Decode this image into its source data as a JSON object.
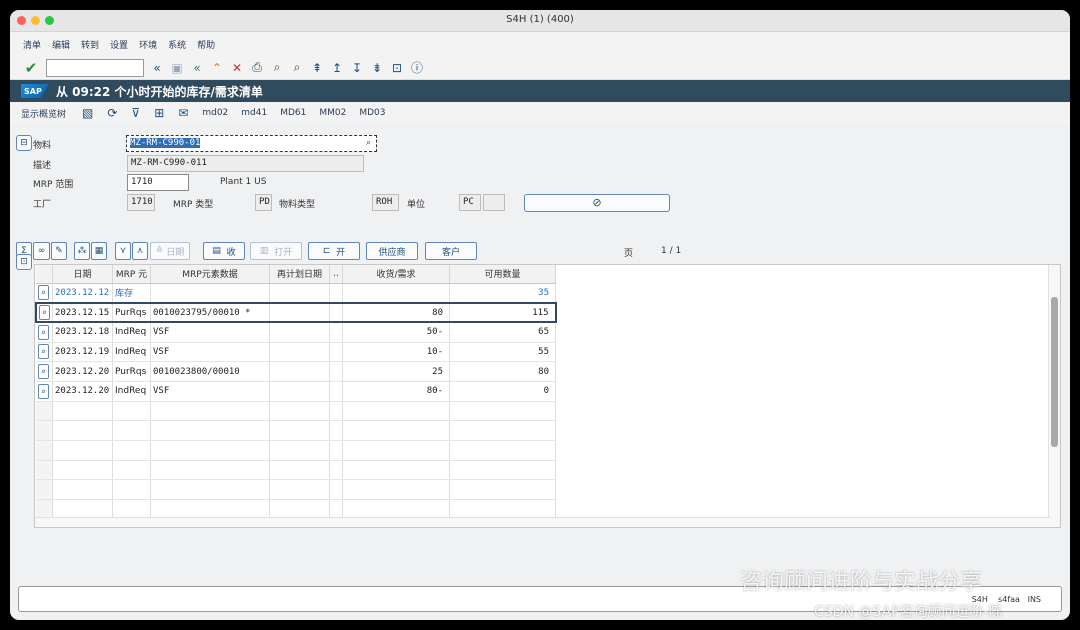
{
  "window": {
    "title": "S4H (1) (400)"
  },
  "menu": [
    "清单",
    "编辑",
    "转到",
    "设置",
    "环境",
    "系统",
    "帮助"
  ],
  "toolbar": {
    "command_value": ""
  },
  "title": "从 09:22 个小时开始的库存/需求清单",
  "sap_logo": "SAP",
  "app_toolbar": {
    "show_tree": "显示概览树",
    "links": [
      "md02",
      "md41",
      "MD61",
      "MM02",
      "MD03"
    ]
  },
  "header": {
    "material_label": "物料",
    "material_value": "MZ-RM-C990-01",
    "desc_label": "描述",
    "desc_value": "MZ-RM-C990-011",
    "mrp_area_label": "MRP 范围",
    "mrp_area_value": "1710",
    "mrp_area_text": "Plant 1 US",
    "plant_label": "工厂",
    "plant_value": "1710",
    "mrp_type_label": "MRP 类型",
    "mrp_type_value": "PD",
    "mat_type_label": "物料类型",
    "mat_type_value": "ROH",
    "unit_label": "单位",
    "unit_value": "PC",
    "unit_extra": ""
  },
  "grid_toolbar": {
    "date_btn": "日期",
    "receipt_btn": "收",
    "open_btn": "打开",
    "open2_btn": "开",
    "vendor_btn": "供应商",
    "customer_btn": "客户",
    "page_label": "页",
    "page_value": "1 /  1"
  },
  "table": {
    "columns": [
      "",
      "日期",
      "MRP 元",
      "MRP元素数据",
      "再计划日期",
      "..",
      "收货/需求",
      "可用数量"
    ],
    "rows": [
      {
        "date": "2023.12.12",
        "element": "库存",
        "data": "",
        "resched": "",
        "qty": "",
        "avail": "35",
        "blue": true
      },
      {
        "date": "2023.12.15",
        "element": "PurRqs",
        "data": "0010023795/00010 *",
        "resched": "",
        "qty": "80",
        "avail": "115",
        "blue": false
      },
      {
        "date": "2023.12.18",
        "element": "IndReq",
        "data": "VSF",
        "resched": "",
        "qty": "50-",
        "avail": "65",
        "blue": false
      },
      {
        "date": "2023.12.19",
        "element": "IndReq",
        "data": "VSF",
        "resched": "",
        "qty": "10-",
        "avail": "55",
        "blue": false
      },
      {
        "date": "2023.12.20",
        "element": "PurRqs",
        "data": "0010023800/00010",
        "resched": "",
        "qty": "25",
        "avail": "80",
        "blue": false
      },
      {
        "date": "2023.12.20",
        "element": "IndReq",
        "data": "VSF",
        "resched": "",
        "qty": "80-",
        "avail": "0",
        "blue": false
      }
    ],
    "empty_rows": 6
  },
  "status": {
    "system": "S4H",
    "client": "s4faa",
    "mode": "INS"
  },
  "watermark": {
    "line1": "咨询顾问进阶与实战分享",
    "line2": "CSDN @SAP咨询顾问进阶-陈"
  }
}
